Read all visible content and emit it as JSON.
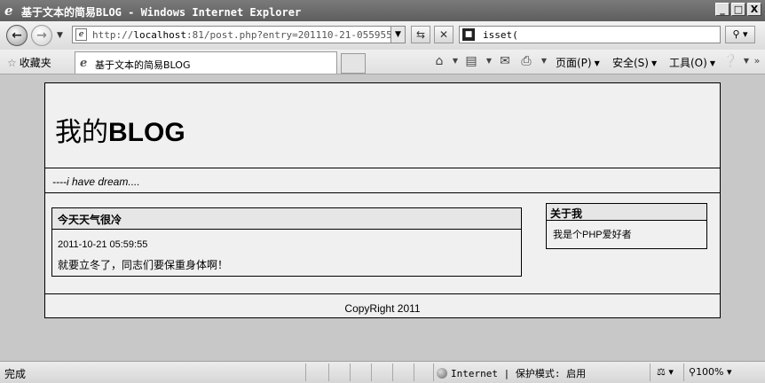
{
  "window": {
    "title": "基于文本的简易BLOG - Windows Internet Explorer",
    "controls": [
      "_",
      "□",
      "X"
    ]
  },
  "address": {
    "url_prefix": "http://",
    "url_host": "localhost",
    "url_rest": ":81/post.php?entry=201110-21-055955",
    "search_value": "isset("
  },
  "favorites": {
    "label": "收藏夹",
    "tab_title": "基于文本的简易BLOG"
  },
  "commands": {
    "page": "页面(P)",
    "safety": "安全(S)",
    "tools": "工具(O)"
  },
  "blog": {
    "title_prefix": "我的",
    "title_bold": "BLOG",
    "tagline": "----i have dream....",
    "post": {
      "title": "今天天气很冷",
      "date": "2011-10-21 05:59:55",
      "body": "就要立冬了，同志们要保重身体啊！"
    },
    "about": {
      "title": "关于我",
      "body": "我是个PHP爱好者"
    },
    "footer": "CopyRight 2011"
  },
  "status": {
    "text": "完成",
    "zone": "Internet | 保护模式: 启用",
    "zoom": "100%"
  },
  "icons": {
    "back": "back-arrow-icon",
    "forward": "forward-arrow-icon",
    "refresh": "refresh-icon",
    "stop": "stop-icon",
    "search": "search-icon",
    "home": "home-icon",
    "feeds": "rss-feed-icon",
    "mail": "mail-icon",
    "print": "print-icon",
    "help": "help-icon",
    "favorites": "star-icon"
  }
}
